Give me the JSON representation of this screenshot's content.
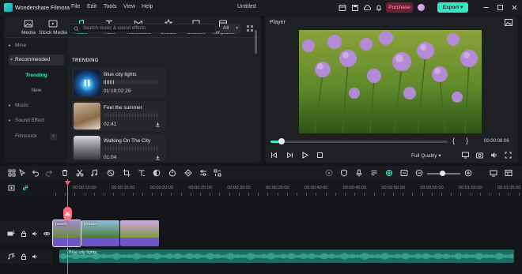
{
  "app": {
    "name": "Wondershare Filmora",
    "menu": [
      "File",
      "Edit",
      "Tools",
      "View",
      "Help"
    ],
    "project_title": "Untitled",
    "purchase_label": "Purchase",
    "export_label": "Export"
  },
  "media_tabs": [
    {
      "label": "Media",
      "icon": "media-icon"
    },
    {
      "label": "Stock Media",
      "icon": "stock-media-icon"
    },
    {
      "label": "Audio",
      "icon": "music-note-icon",
      "active": true
    },
    {
      "label": "Titles",
      "icon": "titles-icon"
    },
    {
      "label": "Transitions",
      "icon": "transitions-icon"
    },
    {
      "label": "Effects",
      "icon": "effects-icon"
    },
    {
      "label": "Stickers",
      "icon": "stickers-icon"
    },
    {
      "label": "Templates",
      "icon": "templates-icon"
    }
  ],
  "sidebar": {
    "items": [
      "Mine",
      "Recommended",
      "Music",
      "Sound Effect",
      "Filmstock"
    ],
    "sub_items": [
      "Trending",
      "New"
    ]
  },
  "search": {
    "placeholder": "Search music & sound effects",
    "filter_value": "All"
  },
  "trending": {
    "section_label": "TRENDING",
    "tracks": [
      {
        "name": "Blue city lights",
        "duration": "01:19;02:29"
      },
      {
        "name": "Feel the summer",
        "duration": "02:41"
      },
      {
        "name": "Walking On The City",
        "duration": "01:04"
      }
    ]
  },
  "player": {
    "title": "Player",
    "timecode": "00:00:08:06",
    "progress_fraction": 0.06,
    "quality": "Full Quality"
  },
  "timeline": {
    "ruler_labels": [
      "00:00:10:00",
      "00:00:15:00",
      "00:00:20:00",
      "00:00:25:00",
      "00:00:30:00",
      "00:00:35:00",
      "00:00:40:00",
      "00:00:45:00",
      "00:00:50:00",
      "00:00:55:00",
      "00:01:00:00",
      "00:01:05:00"
    ],
    "video_track_label": "1",
    "audio_track_label": "1",
    "video_clips": [
      "pexels",
      "pexels-",
      ""
    ],
    "audio_clip": "Blue city lights"
  },
  "colors": {
    "accent": "#3ee8c9",
    "playhead": "#ff5a6e",
    "video_clip": "#6f55c8",
    "audio_clip": "#1b6b60"
  }
}
